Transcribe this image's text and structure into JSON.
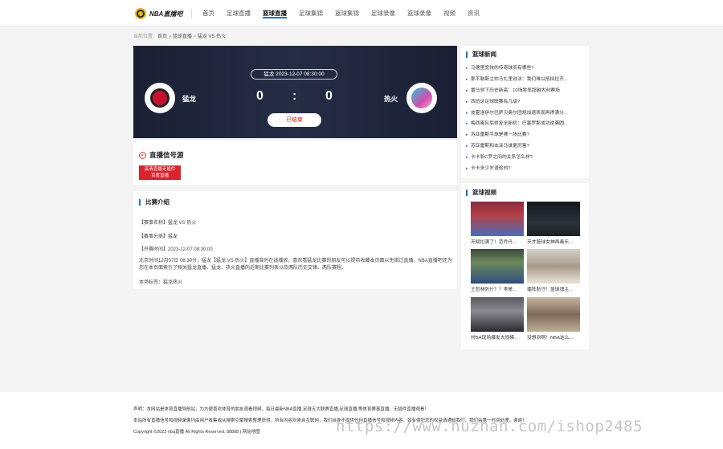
{
  "header": {
    "logo_text": "NBA直播吧",
    "nav": [
      {
        "label": "首页"
      },
      {
        "label": "足球直播"
      },
      {
        "label": "篮球直播",
        "active": true
      },
      {
        "label": "足球集锦"
      },
      {
        "label": "篮球集锦"
      },
      {
        "label": "足球录像"
      },
      {
        "label": "篮球录像"
      },
      {
        "label": "视频"
      },
      {
        "label": "资讯"
      }
    ]
  },
  "breadcrumb": {
    "prefix": "当前位置：",
    "items": [
      "首页",
      "篮球直播",
      "猛龙 VS 热火"
    ],
    "sep": " > "
  },
  "match": {
    "time": "猛龙 2023-12-07 08:30:00",
    "home_name": "猛龙",
    "away_name": "热火",
    "home_score": "0",
    "away_score": "0",
    "sep": ":",
    "status": "已结束"
  },
  "live_source": {
    "title": "直播信号源",
    "button_line1": "高清直播无插件",
    "button_line2": "百度直播"
  },
  "intro": {
    "title": "比赛介绍",
    "name_line": "【赛事名称】猛龙 VS 热火",
    "category_line": "【赛事分类】猛龙",
    "time_line": "【开赛时间】2023-12-07 08:30:00",
    "paragraph": "北京时间12月07日 08:30分，猛龙【猛龙 VS 热火】直播准时在线播放，喜欢看猛龙比赛的朋友可以提前收藏本页面以免错过直播。NBA直播吧还为您在本页面索引了相关猛龙直播、猛龙、热火直播的近期比赛列表以及两队历史交锋、两队赛程。",
    "tags": "本场标签：猛龙热火"
  },
  "news": {
    "title": "篮球新闻",
    "items": [
      "马德里竞技的传奇球员有哪些?",
      "那不勒斯主帅马扎里说法：我们难以抵挡拉齐...",
      "雷马领下历史新高：10场胜率超越大利赛场",
      "西班牙足球联赛有几级?",
      "皮霍洛伊尔巴萨贝奥尔团规加速表现再得满分...",
      "梅西离队后修复全新机：巴塞罗那成功逆袭圆...",
      "苏亚雷斯手球是哪一场比赛?",
      "苏亚雷斯和本泽马谁更厉害?",
      "卡卡和C罗之间的关系怎么样?",
      "卡卡多少岁退役的?"
    ]
  },
  "videos": {
    "title": "篮球视频",
    "items": [
      {
        "caption": "天赋拉满了！范乔丹..."
      },
      {
        "caption": "天才篮球女神再奏乐..."
      },
      {
        "caption": "王哲林防什？？李哥..."
      },
      {
        "caption": "擂阵防守！篮球博主..."
      },
      {
        "caption": "村BA现场爆发大规模..."
      },
      {
        "caption": "没想到啊！NBA这么..."
      }
    ]
  },
  "footer": {
    "line1": "声明：本网站是体育直播导航站，为方便喜欢体育的朋友观看视频，每日最新NBA直播,足球五大联赛直播,足球直播,等体育赛事直播，无插件直播观看！",
    "line2": "本站所有直播信号和视频录像均由用户收集或从搜索引擎搜索整理获得，所有内容均来自互联网，我们自身不提供任何直播信号和视频内容，如有侵犯您的权益请通知我们，我们会第一时间处理，谢谢！",
    "line3": "Copyright ©2023 nba直播 All Rights Reserved. 88888 | 网站地图"
  },
  "watermark": "https://www.huzhan.com/ishop2485"
}
